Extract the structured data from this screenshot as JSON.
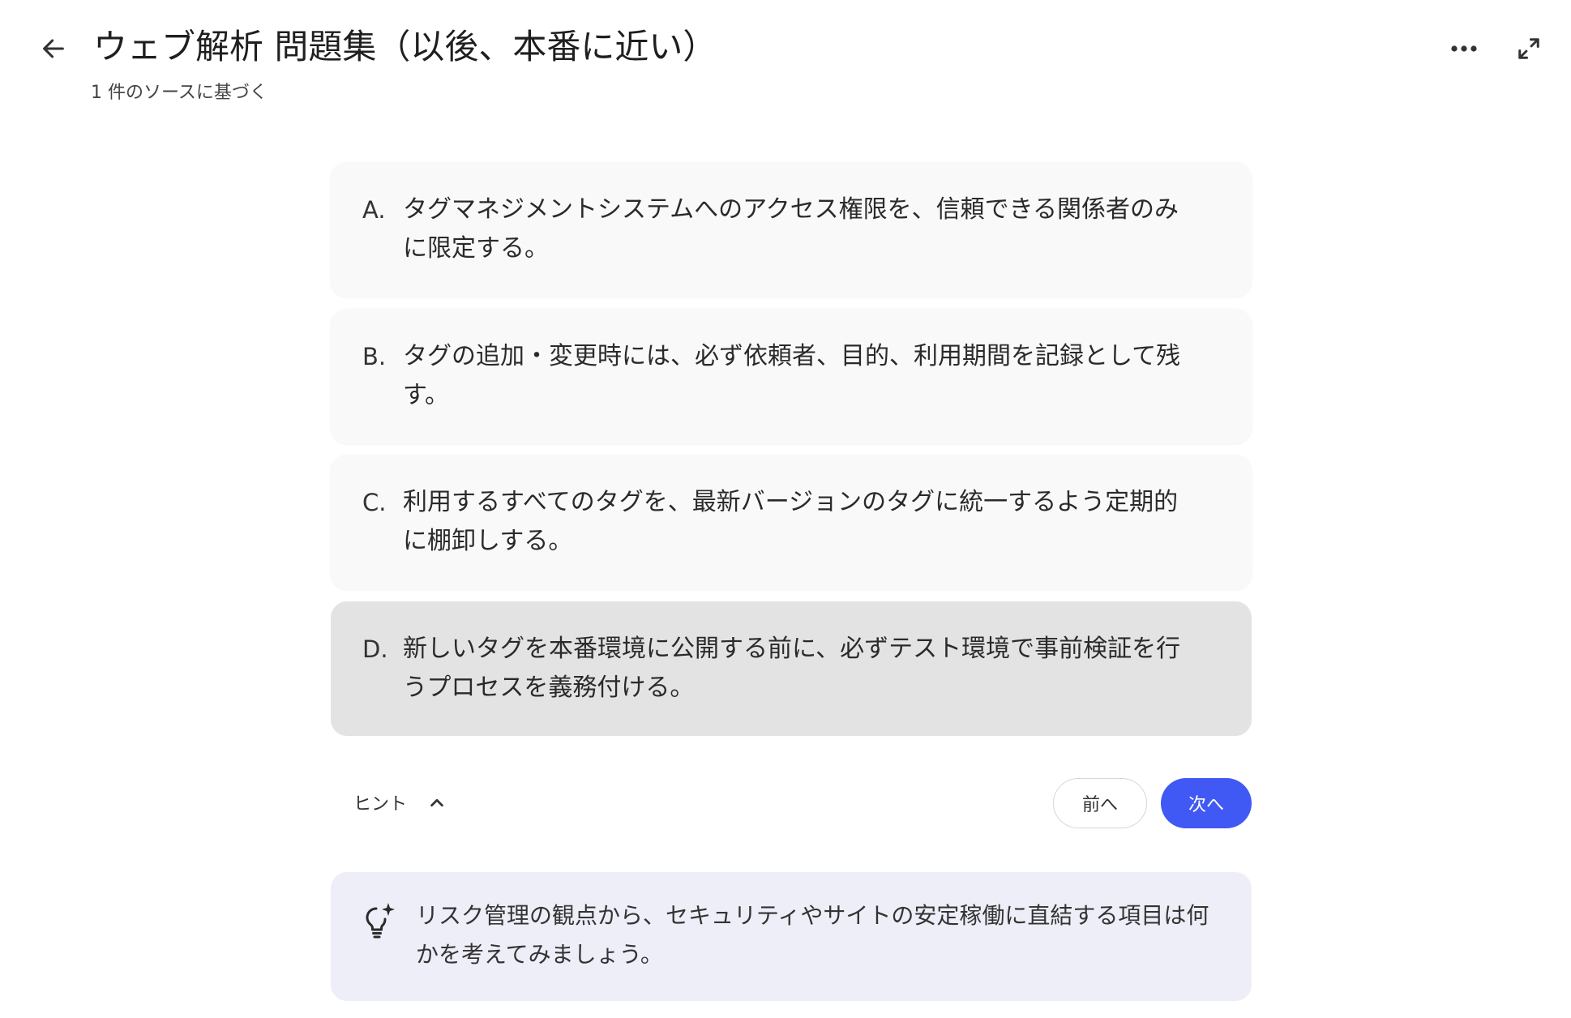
{
  "header": {
    "title": "ウェブ解析 問題集（以後、本番に近い）",
    "subtitle": "1 件のソースに基づく"
  },
  "icons": {
    "back": "arrow-left-icon",
    "more": "more-horizontal-icon",
    "expand": "expand-icon",
    "hint_toggle": "chevron-up-icon",
    "hint": "lightbulb-sparkle-icon"
  },
  "options": [
    {
      "letter": "A.",
      "text": "タグマネジメントシステムへのアクセス権限を、信頼できる関係者のみに限定する。"
    },
    {
      "letter": "B.",
      "text": "タグの追加・変更時には、必ず依頼者、目的、利用期間を記録として残す。"
    },
    {
      "letter": "C.",
      "text": "利用するすべてのタグを、最新バージョンのタグに統一するよう定期的に棚卸しする。"
    },
    {
      "letter": "D.",
      "text": "新しいタグを本番環境に公開する前に、必ずテスト環境で事前検証を行うプロセスを義務付ける。"
    }
  ],
  "selected_option": "D.",
  "hint": {
    "toggle_label": "ヒント",
    "text": "リスク管理の観点から、セキュリティやサイトの安定稼働に直結する項目は何かを考えてみましょう。"
  },
  "nav": {
    "prev_label": "前へ",
    "next_label": "次へ"
  },
  "colors": {
    "accent": "#4159f4",
    "selected_bg": "#e3e3e3",
    "card_bg": "#f9f9f9",
    "hint_bg": "#eeeef9"
  }
}
